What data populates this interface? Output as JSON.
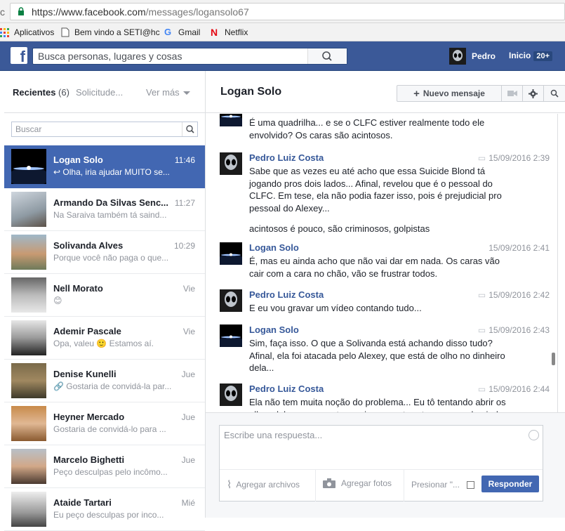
{
  "browser": {
    "url_host": "https://www.facebook.com",
    "url_path": "/messages/logansolo67",
    "bookmarks": [
      "Aplicativos",
      "Bem vindo a SETI@hc",
      "Gmail",
      "Netflix"
    ]
  },
  "fbbar": {
    "logo": "f",
    "search_placeholder": "Busca personas, lugares y cosas",
    "user_name": "Pedro",
    "home_label": "Inicio",
    "home_badge": "20+"
  },
  "left": {
    "tab_recent": "Recientes",
    "tab_recent_count": "(6)",
    "tab_requests": "Solicitude...",
    "tab_more": "Ver más",
    "search_placeholder": "Buscar",
    "threads": [
      {
        "name": "Logan Solo",
        "time": "11:46",
        "snippet": "↩ Olha, iria ajudar MUITO se..."
      },
      {
        "name": "Armando Da Silvas Senc...",
        "time": "11:27",
        "snippet": "Na Saraiva também tá saind..."
      },
      {
        "name": "Solivanda Alves",
        "time": "10:29",
        "snippet": "Porque você não paga o que..."
      },
      {
        "name": "Nell Morato",
        "time": "Vie",
        "snippet": "😊"
      },
      {
        "name": "Ademir Pascale",
        "time": "Vie",
        "snippet": "Opa, valeu 🙂 Estamos aí."
      },
      {
        "name": "Denise Kunelli",
        "time": "Jue",
        "snippet": "🔗 Gostaria de convidá-la par..."
      },
      {
        "name": "Heyner Mercado",
        "time": "Jue",
        "snippet": "Gostaria de convidá-lo para ..."
      },
      {
        "name": "Marcelo Bighetti",
        "time": "Jue",
        "snippet": "Peço desculpas pelo incômo..."
      },
      {
        "name": "Ataide Tartari",
        "time": "Mié",
        "snippet": "Eu peço desculpas por inco..."
      }
    ]
  },
  "conversation": {
    "title": "Logan Solo",
    "new_message": "Nuevo mensaje",
    "messages": [
      {
        "author": "",
        "timestamp": "",
        "body": [
          "É uma quadrilha... e se o CLFC estiver realmente todo ele envolvido? Os caras são acintosos."
        ]
      },
      {
        "author": "Pedro Luiz Costa",
        "timestamp": "15/09/2016 2:39",
        "body": [
          "Sabe que as vezes eu até acho que essa Suicide Blond tá jogando pros dois lados... Afinal, revelou que é o pessoal do CLFC. Em tese, ela não podia fazer isso, pois é prejudicial pro pessoal do Alexey...",
          "acintosos é pouco, são criminosos, golpistas"
        ]
      },
      {
        "author": "Logan Solo",
        "timestamp": "15/09/2016 2:41",
        "body": [
          "É, mas eu ainda acho que não vai dar em nada. Os caras vão cair com a cara no chão, vão se frustrar todos."
        ]
      },
      {
        "author": "Pedro Luiz Costa",
        "timestamp": "15/09/2016 2:42",
        "body": [
          "E eu vou gravar um vídeo contando tudo..."
        ]
      },
      {
        "author": "Logan Solo",
        "timestamp": "15/09/2016 2:43",
        "body": [
          "Sim, faça isso. O que a Solivanda está achando disso tudo? Afinal, ela foi atacada pelo Alexey, que está de olho no dinheiro dela..."
        ]
      },
      {
        "author": "Pedro Luiz Costa",
        "timestamp": "15/09/2016 2:44",
        "body": [
          "Ela não tem muita noção do problema... Eu tô tentando abrir os olhos dela, que a gente precisava contra-atacar, mas ela ainda"
        ]
      }
    ]
  },
  "composer": {
    "placeholder": "Escribe una respuesta...",
    "attach_files": "Agregar archivos",
    "add_photos": "Agregar fotos",
    "press_enter": "Presionar \"...",
    "reply_button": "Responder"
  }
}
